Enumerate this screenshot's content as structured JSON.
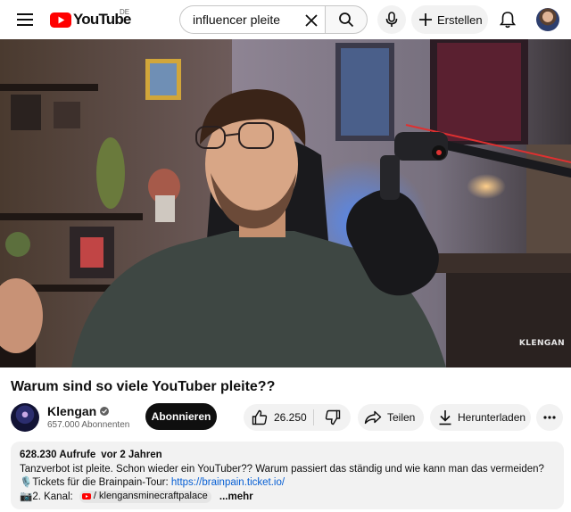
{
  "header": {
    "logo_text": "YouTube",
    "country_code": "DE",
    "search": {
      "value": "influencer pleite"
    },
    "create_label": "Erstellen"
  },
  "player": {
    "watermark": "KLENGAN"
  },
  "video": {
    "title": "Warum sind so viele YouTuber pleite??"
  },
  "owner": {
    "channel_name": "Klengan",
    "subscribers": "657.000 Abonnenten",
    "subscribe_label": "Abonnieren"
  },
  "actions": {
    "like_count": "26.250",
    "share_label": "Teilen",
    "download_label": "Herunterladen"
  },
  "description": {
    "views": "628.230 Aufrufe",
    "date": "vor 2 Jahren",
    "line1": "Tanzverbot ist pleite. Schon wieder ein YouTuber?? Warum passiert das ständig und wie kann man das vermeiden?",
    "tickets_prefix": "🎙️Tickets für die Brainpain-Tour: ",
    "tickets_link": "https://brainpain.ticket.io/",
    "second_channel_prefix": "📷2. Kanal:",
    "second_channel_chip": "/ klengansminecraftpalace",
    "more_label": "...mehr"
  },
  "colors": {
    "brand_red": "#ff0000",
    "link_blue": "#065fd4",
    "subscribe_bg": "#0f0f0f",
    "chip_bg": "#f2f2f2"
  },
  "icons": [
    "menu-icon",
    "youtube-logo-icon",
    "close-icon",
    "search-icon",
    "mic-icon",
    "plus-icon",
    "bell-icon",
    "verified-icon",
    "thumbs-up-icon",
    "thumbs-down-icon",
    "share-icon",
    "download-icon",
    "more-vert-icon"
  ]
}
